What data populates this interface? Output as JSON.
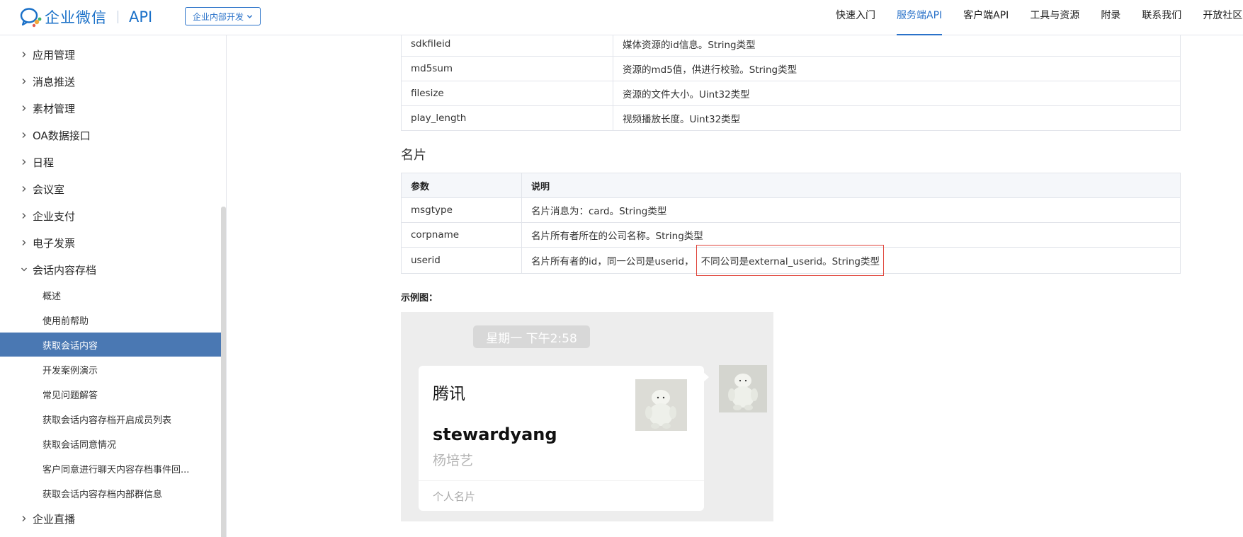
{
  "header": {
    "logo_text": "企业微信",
    "logo_api": "API",
    "dev_select": "企业内部开发",
    "nav": [
      "快速入门",
      "服务端API",
      "客户端API",
      "工具与资源",
      "附录",
      "联系我们",
      "开放社区"
    ],
    "nav_active_index": 1
  },
  "sidebar": {
    "items": [
      "应用管理",
      "消息推送",
      "素材管理",
      "OA数据接口",
      "日程",
      "会议室",
      "企业支付",
      "电子发票",
      "会话内容存档"
    ],
    "sub_items": [
      "概述",
      "使用前帮助",
      "获取会话内容",
      "开发案例演示",
      "常见问题解答",
      "获取会话内容存档开启成员列表",
      "获取会话同意情况",
      "客户同意进行聊天内容存档事件回...",
      "获取会话内容存档内部群信息"
    ],
    "active_sub": "获取会话内容",
    "last_item": "企业直播"
  },
  "video_table": {
    "rows": [
      {
        "param": "sdkfileid",
        "desc": "媒体资源的id信息。String类型"
      },
      {
        "param": "md5sum",
        "desc": "资源的md5值，供进行校验。String类型"
      },
      {
        "param": "filesize",
        "desc": "资源的文件大小。Uint32类型"
      },
      {
        "param": "play_length",
        "desc": "视频播放长度。Uint32类型"
      }
    ]
  },
  "card_section": {
    "title": "名片",
    "headers": [
      "参数",
      "说明"
    ],
    "rows": [
      {
        "param": "msgtype",
        "desc": "名片消息为：card。String类型"
      },
      {
        "param": "corpname",
        "desc": "名片所有者所在的公司名称。String类型"
      },
      {
        "param": "userid",
        "desc": "名片所有者的id，同一公司是userid，",
        "desc_highlight": "不同公司是external_userid。String类型"
      }
    ],
    "example_label": "示例图："
  },
  "example": {
    "time": "星期一 下午2:58",
    "company": "腾讯",
    "name": "stewardyang",
    "alias": "杨培艺",
    "footer": "个人名片"
  },
  "colors": {
    "accent": "#2a72c9",
    "sidebar_active": "#4a78b3",
    "highlight_box": "#e0443a"
  }
}
